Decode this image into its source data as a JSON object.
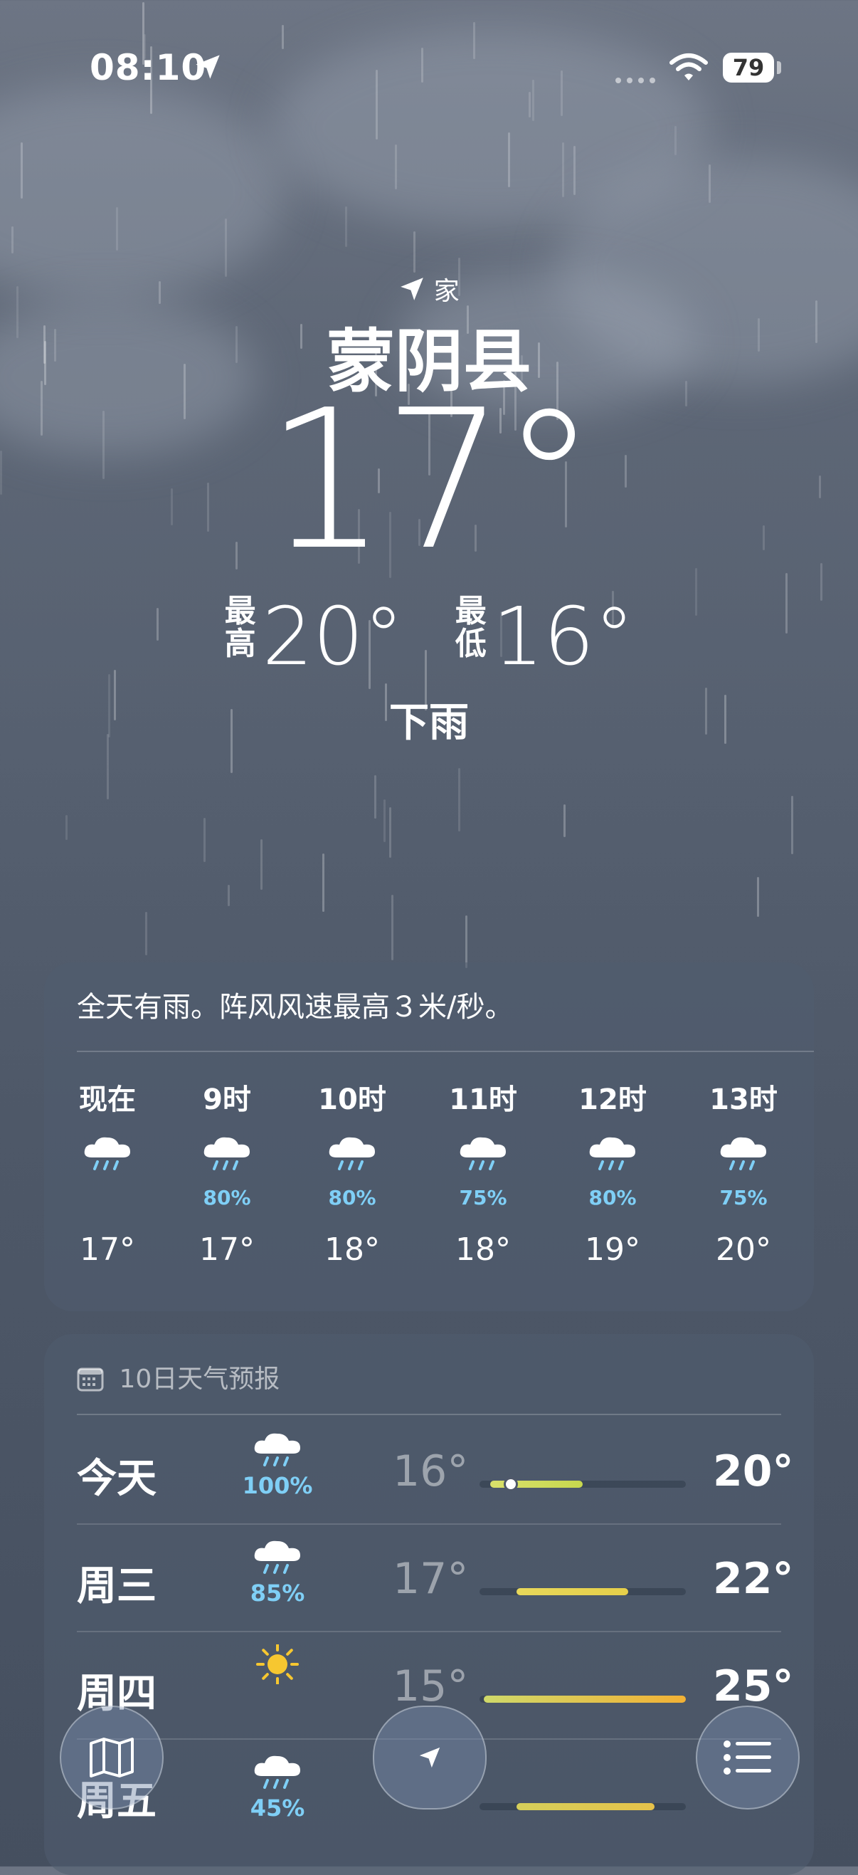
{
  "status": {
    "time": "08:10",
    "battery": "79"
  },
  "location": {
    "label": "家",
    "city": "蒙阴县",
    "temp": "17°",
    "high_label": "最高",
    "high": "20°",
    "low_label": "最低",
    "low": "16°",
    "condition": "下雨"
  },
  "hourly": {
    "summary": "全天有雨。阵风风速最高３米/秒。",
    "items": [
      {
        "hour": "现在",
        "icon": "rain-cloud-icon",
        "precip": "",
        "temp": "17°"
      },
      {
        "hour": "9时",
        "icon": "rain-cloud-icon",
        "precip": "80%",
        "temp": "17°"
      },
      {
        "hour": "10时",
        "icon": "rain-cloud-icon",
        "precip": "80%",
        "temp": "18°"
      },
      {
        "hour": "11时",
        "icon": "rain-cloud-icon",
        "precip": "75%",
        "temp": "18°"
      },
      {
        "hour": "12时",
        "icon": "rain-cloud-icon",
        "precip": "80%",
        "temp": "19°"
      },
      {
        "hour": "13时",
        "icon": "rain-cloud-icon",
        "precip": "75%",
        "temp": "20°"
      }
    ]
  },
  "daily": {
    "title": "10日天气预报",
    "items": [
      {
        "day": "今天",
        "icon": "rain-cloud-icon",
        "precip": "100%",
        "low": "16°",
        "high": "20°",
        "range_start": 0.05,
        "range_end": 0.5,
        "current": 0.15,
        "colors": [
          "#d9e06b",
          "#c7d84e"
        ]
      },
      {
        "day": "周三",
        "icon": "rain-cloud-icon",
        "precip": "85%",
        "low": "17°",
        "high": "22°",
        "range_start": 0.18,
        "range_end": 0.72,
        "colors": [
          "#e8d85a",
          "#e6cf4a"
        ]
      },
      {
        "day": "周四",
        "icon": "sun-icon",
        "precip": "",
        "low": "15°",
        "high": "25°",
        "range_start": 0.02,
        "range_end": 1.0,
        "colors": [
          "#cfd96a",
          "#f2b135"
        ]
      },
      {
        "day": "周五",
        "icon": "rain-cloud-icon",
        "precip": "45%",
        "low": "",
        "high": "",
        "range_start": 0.18,
        "range_end": 0.85,
        "colors": [
          "#d6cf5a",
          "#e6c24a"
        ]
      }
    ]
  },
  "nav": {
    "left": "map-icon",
    "center": "location-arrow-icon",
    "right": "list-icon"
  }
}
